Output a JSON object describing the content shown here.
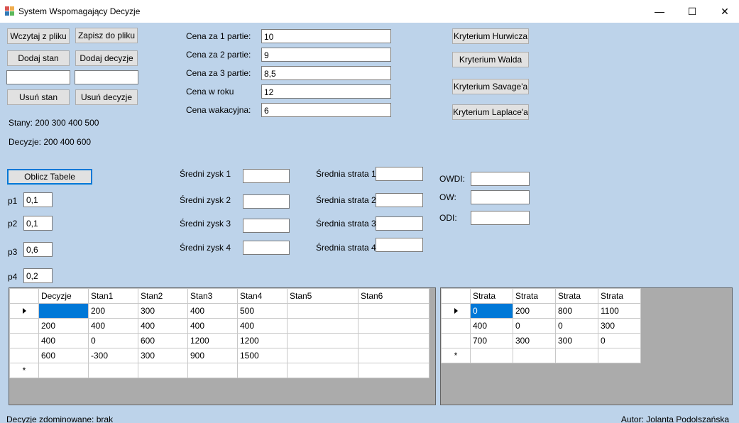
{
  "window": {
    "title": "System Wspomagający Decyzje",
    "minimize_glyph": "—",
    "maximize_glyph": "☐",
    "close_glyph": "✕",
    "icon": "app-icon"
  },
  "buttons": {
    "load": "Wczytaj z pliku",
    "save": "Zapisz do pliku",
    "add_state": "Dodaj stan",
    "add_decision": "Dodaj decyzje",
    "remove_state": "Usuń stan",
    "remove_decision": "Usuń decyzje",
    "compute_table": "Oblicz Tabele",
    "hurwicz": "Kryterium Hurwicza",
    "wald": "Kryterium Walda",
    "savage": "Kryterium Savage'a",
    "laplace": "Kryterium Laplace'a"
  },
  "inputs": {
    "state_input": "",
    "decision_input": ""
  },
  "info": {
    "states": "Stany: 200 300 400 500",
    "decisions": "Decyzje: 200 400 600"
  },
  "prices": [
    {
      "label": "Cena za 1 partie:",
      "value": "10"
    },
    {
      "label": "Cena za 2 partie:",
      "value": "9"
    },
    {
      "label": "Cena za 3 partie:",
      "value": "8,5"
    },
    {
      "label": "Cena w roku",
      "value": "12"
    },
    {
      "label": "Cena wakacyjna:",
      "value": "6"
    }
  ],
  "probabilities": [
    {
      "label": "p1",
      "value": "0,1"
    },
    {
      "label": "p2",
      "value": "0,1"
    },
    {
      "label": "p3",
      "value": "0,6"
    },
    {
      "label": "p4",
      "value": "0,2"
    }
  ],
  "avg_profit": [
    {
      "label": "Średni zysk 1",
      "value": ""
    },
    {
      "label": "Średni zysk 2",
      "value": ""
    },
    {
      "label": "Średni zysk 3",
      "value": ""
    },
    {
      "label": "Średni zysk 4",
      "value": ""
    }
  ],
  "avg_loss": [
    {
      "label": "Średnia strata 1",
      "value": ""
    },
    {
      "label": "Średnia strata 2",
      "value": ""
    },
    {
      "label": "Średnia strata 3",
      "value": ""
    },
    {
      "label": "Średnia strata 4",
      "value": ""
    }
  ],
  "metrics": [
    {
      "label": "OWDI:",
      "value": ""
    },
    {
      "label": "OW:",
      "value": ""
    },
    {
      "label": "ODI:",
      "value": ""
    }
  ],
  "main_grid": {
    "headers": [
      "Decyzje",
      "Stan1",
      "Stan2",
      "Stan3",
      "Stan4",
      "Stan5",
      "Stan6"
    ],
    "rows": [
      [
        "",
        "200",
        "300",
        "400",
        "500",
        "",
        ""
      ],
      [
        "200",
        "400",
        "400",
        "400",
        "400",
        "",
        ""
      ],
      [
        "400",
        "0",
        "600",
        "1200",
        "1200",
        "",
        ""
      ],
      [
        "600",
        "-300",
        "300",
        "900",
        "1500",
        "",
        ""
      ]
    ],
    "new_row_marker": "*"
  },
  "loss_grid": {
    "headers": [
      "Strata",
      "Strata",
      "Strata",
      "Strata"
    ],
    "rows": [
      [
        "0",
        "200",
        "800",
        "1100"
      ],
      [
        "400",
        "0",
        "0",
        "300"
      ],
      [
        "700",
        "300",
        "300",
        "0"
      ]
    ],
    "new_row_marker": "*"
  },
  "status": {
    "dominated": "Decyzje zdominowane: brak",
    "author": "Autor: Jolanta Podolszańska"
  }
}
